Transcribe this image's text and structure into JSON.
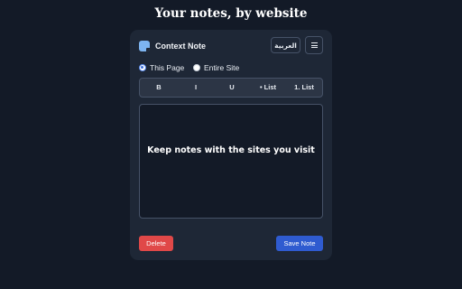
{
  "page": {
    "title": "Your notes, by website"
  },
  "app": {
    "name": "Context Note",
    "logo_icon": "note-icon"
  },
  "header": {
    "language_label": "العربية",
    "menu_icon": "hamburger-menu-icon"
  },
  "scope": {
    "options": [
      {
        "label": "This Page",
        "checked": true
      },
      {
        "label": "Entire Site",
        "checked": false
      }
    ]
  },
  "toolbar": {
    "bold": "B",
    "italic": "I",
    "underline": "U",
    "bullet_list": "• List",
    "numbered_list": "1. List"
  },
  "editor": {
    "hint": "Keep notes with the sites you visit"
  },
  "actions": {
    "delete_label": "Delete",
    "save_label": "Save Note"
  },
  "colors": {
    "background": "#131a27",
    "panel": "#1e2736",
    "delete": "#e04848",
    "save": "#2f5bd0",
    "accent": "#7db4f0"
  }
}
